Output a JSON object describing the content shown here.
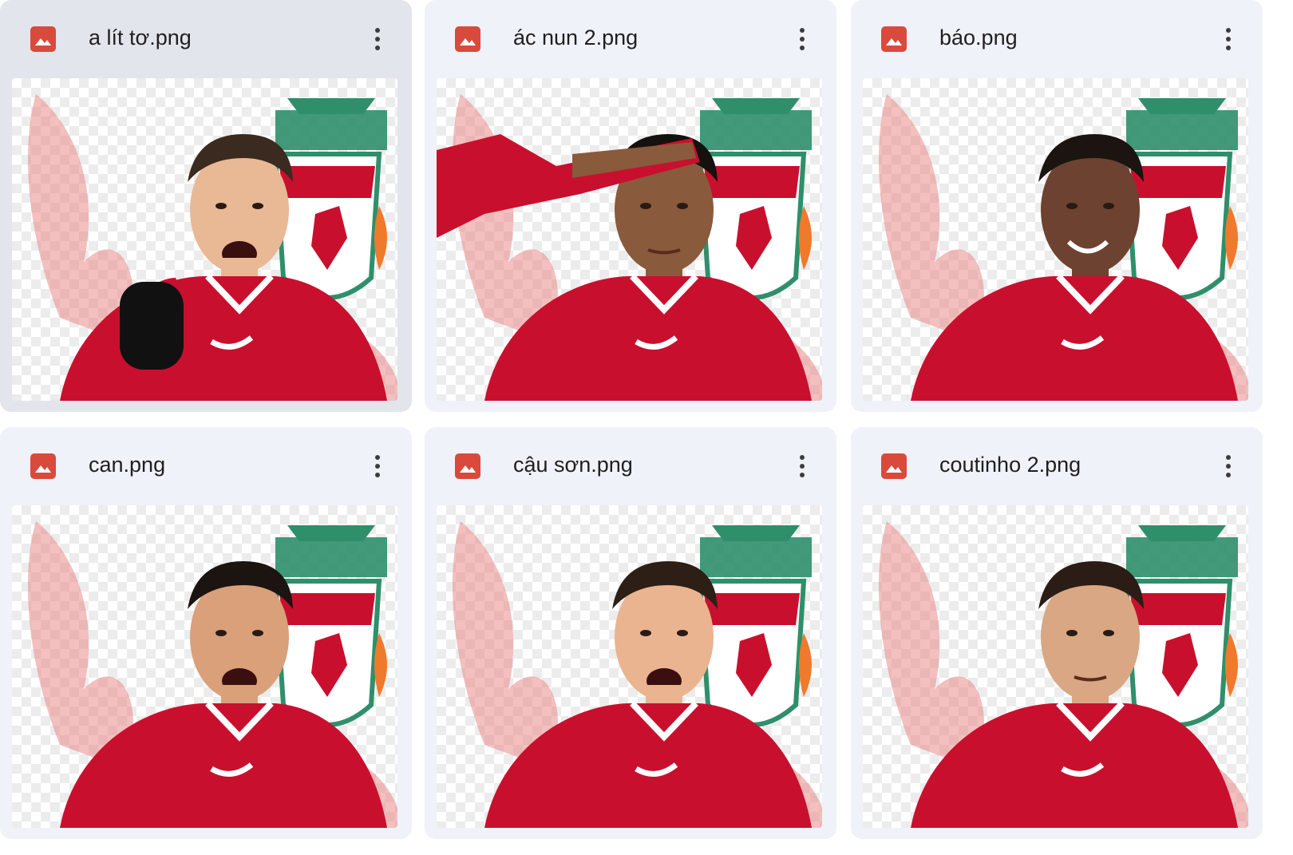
{
  "files": [
    {
      "name": "a lít tơ.png",
      "selected": true,
      "skin": "#e9b895",
      "hair": "#3a2a20",
      "pose": "fist"
    },
    {
      "name": "ác nun 2.png",
      "selected": false,
      "skin": "#8a5a3c",
      "hair": "#15110e",
      "pose": "salute"
    },
    {
      "name": "báo.png",
      "selected": false,
      "skin": "#6e4230",
      "hair": "#1b1410",
      "pose": "smile"
    },
    {
      "name": "can.png",
      "selected": false,
      "skin": "#d9a07a",
      "hair": "#1c1410",
      "pose": "shout"
    },
    {
      "name": "cậu sơn.png",
      "selected": false,
      "skin": "#e9b48f",
      "hair": "#2e1f16",
      "pose": "shout"
    },
    {
      "name": "coutinho 2.png",
      "selected": false,
      "skin": "#d9a784",
      "hair": "#2b1d15",
      "pose": "look-up"
    }
  ],
  "colors": {
    "card_bg": "#eff2f8",
    "card_selected_bg": "#e2e5eb",
    "file_icon": "#d94a3c",
    "kit_red": "#c8102e",
    "crest_green": "#2f8f6b"
  },
  "icons": {
    "file_type": "image-file-icon",
    "menu": "more-vertical-icon"
  }
}
